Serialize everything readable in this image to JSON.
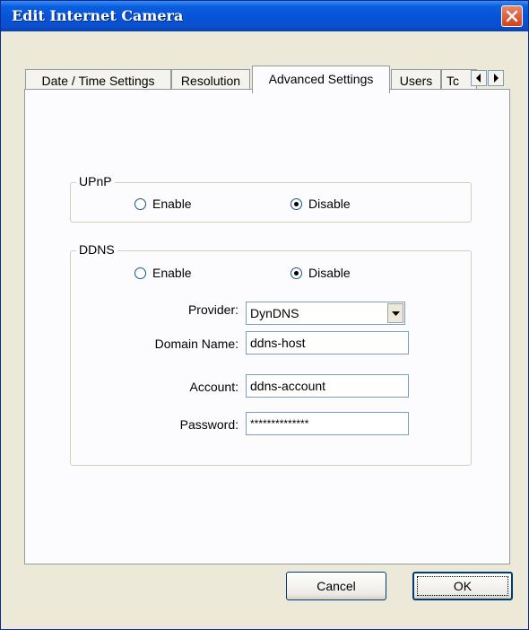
{
  "window": {
    "title": "Edit Internet Camera"
  },
  "tabs": [
    {
      "label": "Date / Time Settings",
      "active": false
    },
    {
      "label": "Resolution",
      "active": false
    },
    {
      "label": "Advanced Settings",
      "active": true
    },
    {
      "label": "Users",
      "active": false
    },
    {
      "label": "Tc",
      "active": false
    }
  ],
  "upnp": {
    "label": "UPnP",
    "enable_label": "Enable",
    "disable_label": "Disable",
    "selected": "Disable"
  },
  "ddns": {
    "label": "DDNS",
    "enable_label": "Enable",
    "disable_label": "Disable",
    "selected": "Disable",
    "provider_label": "Provider:",
    "provider_value": "DynDNS",
    "domain_label": "Domain Name:",
    "domain_value": "ddns-host",
    "account_label": "Account:",
    "account_value": "ddns-account",
    "password_label": "Password:",
    "password_value": "**************"
  },
  "buttons": {
    "cancel": "Cancel",
    "ok": "OK"
  },
  "colors": {
    "titlebar": "#0753d8",
    "dialog_bg": "#ece9d8",
    "panel_bg": "#fcfcfe",
    "radio_dot": "#21a121"
  },
  "icons": [
    "close-icon",
    "tab-scroll-left-icon",
    "tab-scroll-right-icon",
    "dropdown-arrow-icon"
  ]
}
